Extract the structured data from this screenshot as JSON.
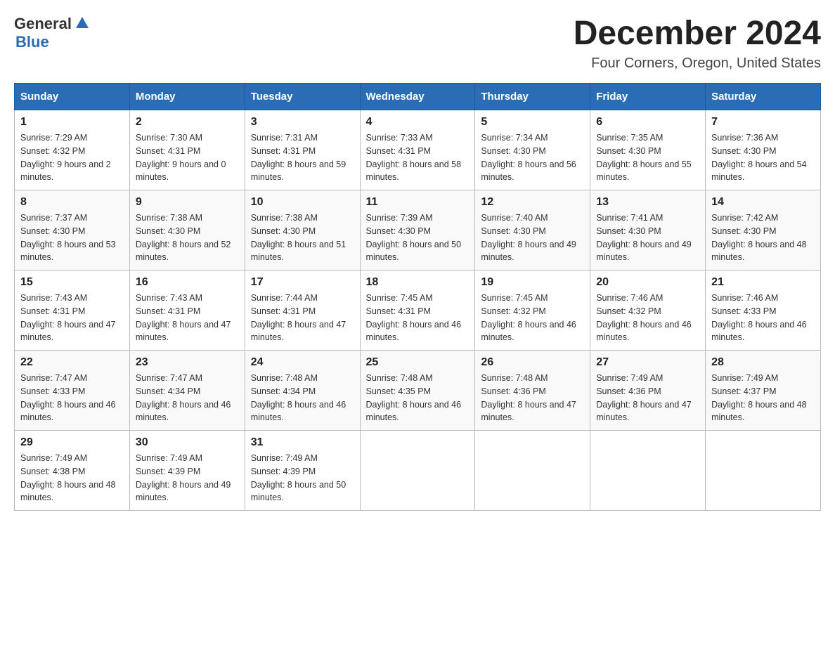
{
  "header": {
    "logo_general": "General",
    "logo_blue": "Blue",
    "month_title": "December 2024",
    "location": "Four Corners, Oregon, United States"
  },
  "days_of_week": [
    "Sunday",
    "Monday",
    "Tuesday",
    "Wednesday",
    "Thursday",
    "Friday",
    "Saturday"
  ],
  "weeks": [
    [
      {
        "day": "1",
        "sunrise": "7:29 AM",
        "sunset": "4:32 PM",
        "daylight": "9 hours and 2 minutes."
      },
      {
        "day": "2",
        "sunrise": "7:30 AM",
        "sunset": "4:31 PM",
        "daylight": "9 hours and 0 minutes."
      },
      {
        "day": "3",
        "sunrise": "7:31 AM",
        "sunset": "4:31 PM",
        "daylight": "8 hours and 59 minutes."
      },
      {
        "day": "4",
        "sunrise": "7:33 AM",
        "sunset": "4:31 PM",
        "daylight": "8 hours and 58 minutes."
      },
      {
        "day": "5",
        "sunrise": "7:34 AM",
        "sunset": "4:30 PM",
        "daylight": "8 hours and 56 minutes."
      },
      {
        "day": "6",
        "sunrise": "7:35 AM",
        "sunset": "4:30 PM",
        "daylight": "8 hours and 55 minutes."
      },
      {
        "day": "7",
        "sunrise": "7:36 AM",
        "sunset": "4:30 PM",
        "daylight": "8 hours and 54 minutes."
      }
    ],
    [
      {
        "day": "8",
        "sunrise": "7:37 AM",
        "sunset": "4:30 PM",
        "daylight": "8 hours and 53 minutes."
      },
      {
        "day": "9",
        "sunrise": "7:38 AM",
        "sunset": "4:30 PM",
        "daylight": "8 hours and 52 minutes."
      },
      {
        "day": "10",
        "sunrise": "7:38 AM",
        "sunset": "4:30 PM",
        "daylight": "8 hours and 51 minutes."
      },
      {
        "day": "11",
        "sunrise": "7:39 AM",
        "sunset": "4:30 PM",
        "daylight": "8 hours and 50 minutes."
      },
      {
        "day": "12",
        "sunrise": "7:40 AM",
        "sunset": "4:30 PM",
        "daylight": "8 hours and 49 minutes."
      },
      {
        "day": "13",
        "sunrise": "7:41 AM",
        "sunset": "4:30 PM",
        "daylight": "8 hours and 49 minutes."
      },
      {
        "day": "14",
        "sunrise": "7:42 AM",
        "sunset": "4:30 PM",
        "daylight": "8 hours and 48 minutes."
      }
    ],
    [
      {
        "day": "15",
        "sunrise": "7:43 AM",
        "sunset": "4:31 PM",
        "daylight": "8 hours and 47 minutes."
      },
      {
        "day": "16",
        "sunrise": "7:43 AM",
        "sunset": "4:31 PM",
        "daylight": "8 hours and 47 minutes."
      },
      {
        "day": "17",
        "sunrise": "7:44 AM",
        "sunset": "4:31 PM",
        "daylight": "8 hours and 47 minutes."
      },
      {
        "day": "18",
        "sunrise": "7:45 AM",
        "sunset": "4:31 PM",
        "daylight": "8 hours and 46 minutes."
      },
      {
        "day": "19",
        "sunrise": "7:45 AM",
        "sunset": "4:32 PM",
        "daylight": "8 hours and 46 minutes."
      },
      {
        "day": "20",
        "sunrise": "7:46 AM",
        "sunset": "4:32 PM",
        "daylight": "8 hours and 46 minutes."
      },
      {
        "day": "21",
        "sunrise": "7:46 AM",
        "sunset": "4:33 PM",
        "daylight": "8 hours and 46 minutes."
      }
    ],
    [
      {
        "day": "22",
        "sunrise": "7:47 AM",
        "sunset": "4:33 PM",
        "daylight": "8 hours and 46 minutes."
      },
      {
        "day": "23",
        "sunrise": "7:47 AM",
        "sunset": "4:34 PM",
        "daylight": "8 hours and 46 minutes."
      },
      {
        "day": "24",
        "sunrise": "7:48 AM",
        "sunset": "4:34 PM",
        "daylight": "8 hours and 46 minutes."
      },
      {
        "day": "25",
        "sunrise": "7:48 AM",
        "sunset": "4:35 PM",
        "daylight": "8 hours and 46 minutes."
      },
      {
        "day": "26",
        "sunrise": "7:48 AM",
        "sunset": "4:36 PM",
        "daylight": "8 hours and 47 minutes."
      },
      {
        "day": "27",
        "sunrise": "7:49 AM",
        "sunset": "4:36 PM",
        "daylight": "8 hours and 47 minutes."
      },
      {
        "day": "28",
        "sunrise": "7:49 AM",
        "sunset": "4:37 PM",
        "daylight": "8 hours and 48 minutes."
      }
    ],
    [
      {
        "day": "29",
        "sunrise": "7:49 AM",
        "sunset": "4:38 PM",
        "daylight": "8 hours and 48 minutes."
      },
      {
        "day": "30",
        "sunrise": "7:49 AM",
        "sunset": "4:39 PM",
        "daylight": "8 hours and 49 minutes."
      },
      {
        "day": "31",
        "sunrise": "7:49 AM",
        "sunset": "4:39 PM",
        "daylight": "8 hours and 50 minutes."
      },
      null,
      null,
      null,
      null
    ]
  ]
}
